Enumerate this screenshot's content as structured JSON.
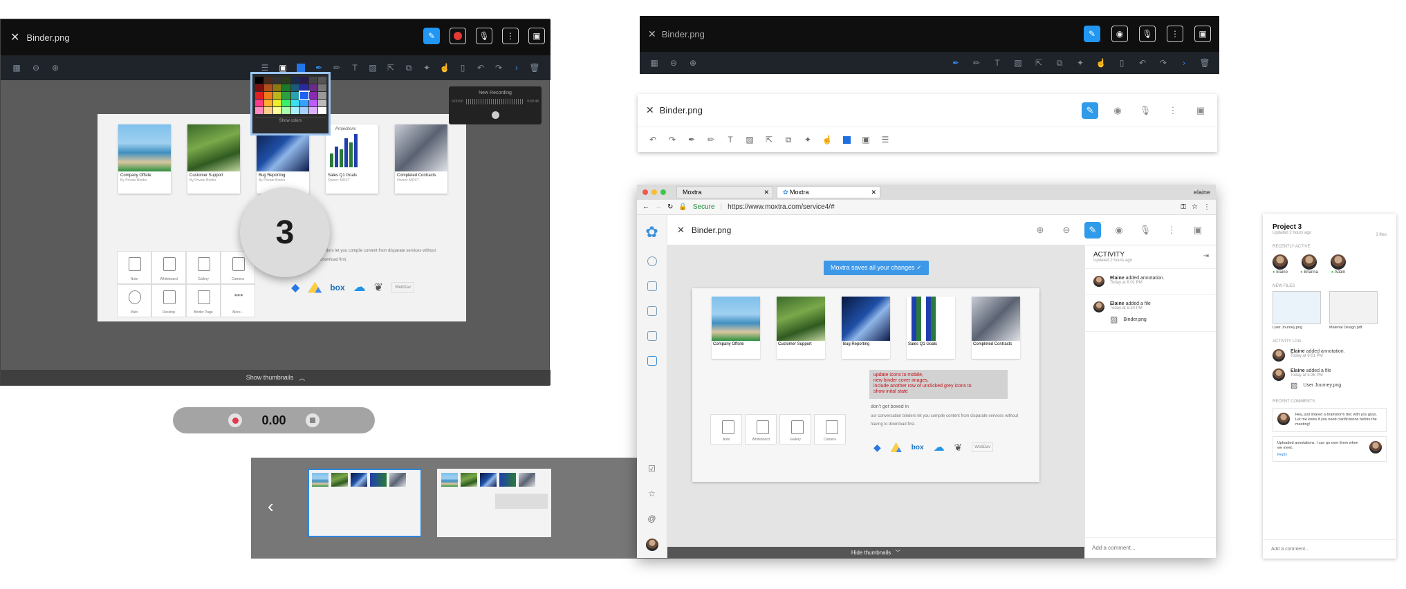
{
  "file_name": "Binder.png",
  "editor_dark": {
    "recording_popup": {
      "title": "New Recording",
      "time_left": "0:00:00",
      "time_right": "0:00:48"
    },
    "color_popup": {
      "show_colors": "Show colors"
    },
    "step_number": "3",
    "show_thumbnails": "Show thumbnails"
  },
  "tiles": [
    {
      "title": "Company Offsite",
      "sub": "By Private Binder"
    },
    {
      "title": "Customer Support",
      "sub": "By Private Binder"
    },
    {
      "title": "Bug Reporting",
      "sub": "By Private Binder"
    },
    {
      "title": "Sales Q1 Goals",
      "sub": "Owner: MOXT"
    },
    {
      "title": "Completed Contracts",
      "sub": "Owner: MOXT"
    }
  ],
  "chart_tile_heading": "Projections",
  "binder_text": "binders let you compile content from disparate services without",
  "binder_text2": "download first.",
  "add_items": [
    "Note",
    "Whiteboard",
    "Gallery",
    "Camera",
    "Web",
    "Desktop",
    "Binder Page",
    "More..."
  ],
  "services": [
    "dropbox",
    "drive",
    "box",
    "onedrive",
    "evernote",
    "WebDav"
  ],
  "recorder": {
    "time": "0.00"
  },
  "browser": {
    "tabs": [
      "Moxtra",
      "Moxtra"
    ],
    "user": "elaine",
    "secure_label": "Secure",
    "url": "https://www.moxtra.com/service4/#",
    "toast": "Moxtra saves all your changes",
    "annotation_lines": [
      "update icons to mobile,",
      "new binder cover images,",
      "include another row of unclicked grey icons to",
      "show inital state"
    ],
    "dont_get_boxed": "don't get boxed in",
    "conversation_text": "our conversation binders let you compile content from disparate services without",
    "conversation_text2": "having to download first.",
    "hide_thumbnails": "Hide thumbnails",
    "activity": {
      "title": "ACTIVITY",
      "updated": "Updated 2 hours ago",
      "items": [
        {
          "user": "Elaine",
          "action": " added annotation.",
          "time": "Today at 6:01 PM"
        },
        {
          "user": "Elaine",
          "action": " added a file",
          "time": "Today at 5:34 PM",
          "file": "Binder.png"
        }
      ],
      "comment_placeholder": "Add a comment..."
    }
  },
  "project_panel": {
    "title": "Project 3",
    "updated": "Updated 2 hours ago",
    "files_count": "3 files",
    "recently_active_label": "RECENTLY ACTIVE",
    "people": [
      "Elaine",
      "Brianna",
      "Adam"
    ],
    "new_files_label": "NEW FILES",
    "files": [
      "User Journey.png",
      "Material Design.pdf"
    ],
    "activity_log_label": "ACTIVITY LOG",
    "log": [
      {
        "user": "Elaine",
        "action": " added annotation.",
        "time": "Today at 6:01 PM"
      },
      {
        "user": "Elaine",
        "action": " added a file",
        "time": "Today at 5:36 PM",
        "file": "User Journey.png"
      }
    ],
    "recent_comments_label": "RECENT COMMENTS",
    "comments": [
      "Hey, just shared a brainstorm doc with you guys. Let me know if you need clarifications before the meeting!",
      "Uploaded annotations. I can go over them when we meet."
    ],
    "reply": "Reply",
    "comment_placeholder": "Add a comment..."
  },
  "colors": {
    "accent": "#2196f3",
    "dark_bar": "#0f0f0f",
    "annotation_red": "#c2121a"
  }
}
